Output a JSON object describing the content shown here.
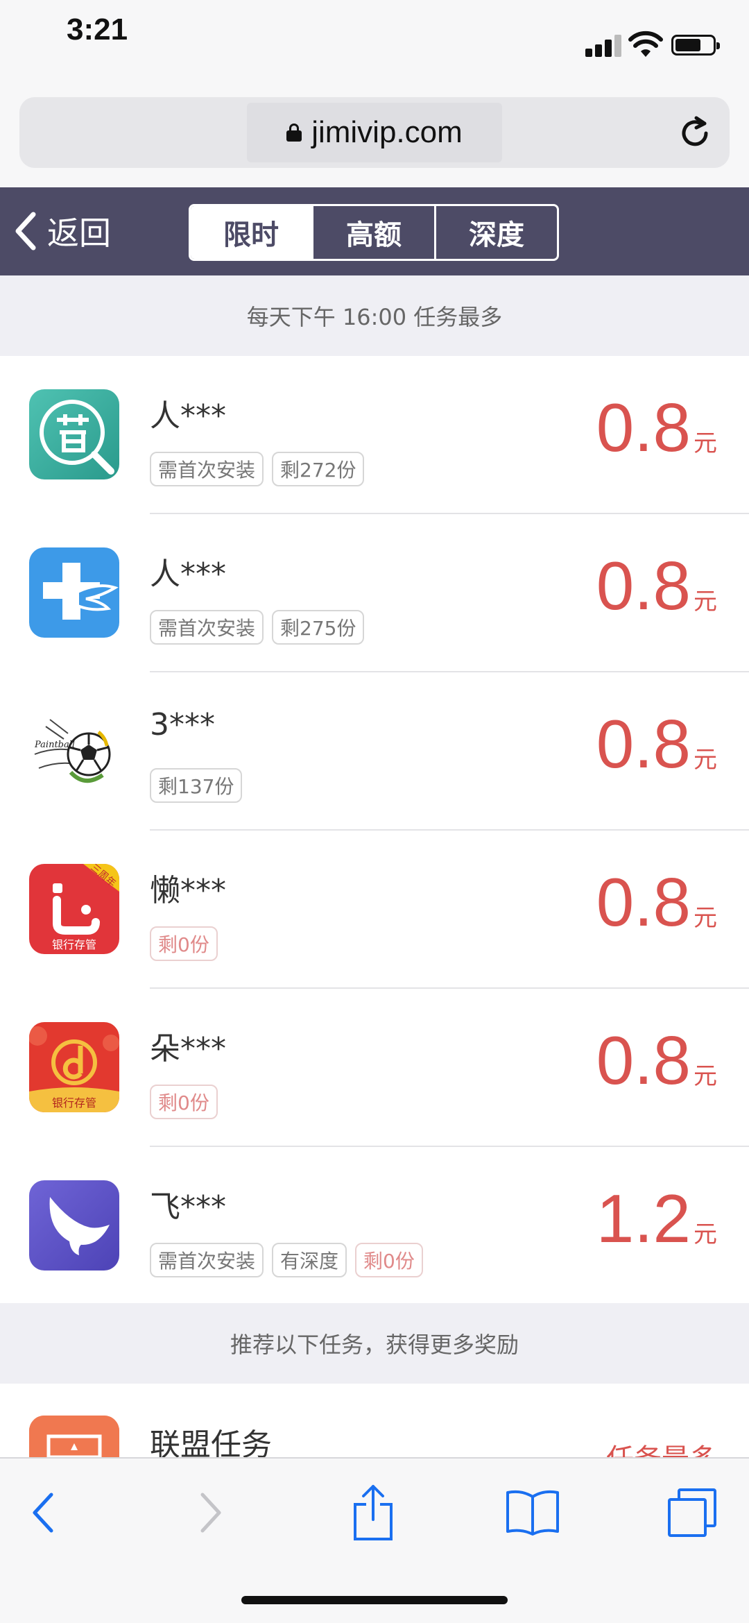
{
  "status_bar": {
    "time": "3:21"
  },
  "browser": {
    "url": "jimivip.com"
  },
  "nav": {
    "back_label": "返回",
    "tabs": [
      {
        "label": "限时",
        "active": true
      },
      {
        "label": "高额",
        "active": false
      },
      {
        "label": "深度",
        "active": false
      }
    ]
  },
  "banner_top": "每天下午 16:00 任务最多",
  "tasks": [
    {
      "name": "人***",
      "tags": [
        {
          "text": "需首次安装",
          "style": "gray"
        },
        {
          "text": "剩272份",
          "style": "gray"
        }
      ],
      "amount": "0.8",
      "unit": "元",
      "icon": "magnifier-app-icon"
    },
    {
      "name": "人***",
      "tags": [
        {
          "text": "需首次安装",
          "style": "gray"
        },
        {
          "text": "剩275份",
          "style": "gray"
        }
      ],
      "amount": "0.8",
      "unit": "元",
      "icon": "medical-cross-app-icon"
    },
    {
      "name": "3***",
      "tags": [
        {
          "text": "剩137份",
          "style": "gray"
        }
      ],
      "amount": "0.8",
      "unit": "元",
      "icon": "soccer-ball-app-icon"
    },
    {
      "name": "懒***",
      "tags": [
        {
          "text": "剩0份",
          "style": "red"
        }
      ],
      "amount": "0.8",
      "unit": "元",
      "icon": "bank-deposit-app-icon"
    },
    {
      "name": "朵***",
      "tags": [
        {
          "text": "剩0份",
          "style": "red"
        }
      ],
      "amount": "0.8",
      "unit": "元",
      "icon": "bank-deposit-d-app-icon"
    },
    {
      "name": "飞***",
      "tags": [
        {
          "text": "需首次安装",
          "style": "gray"
        },
        {
          "text": "有深度",
          "style": "gray"
        },
        {
          "text": "剩0份",
          "style": "red"
        }
      ],
      "amount": "1.2",
      "unit": "元",
      "icon": "bird-app-icon"
    }
  ],
  "banner_bottom": "推荐以下任务，获得更多奖励",
  "alliance": {
    "name": "联盟任务",
    "hint": "任务最多"
  },
  "icon_texts": {
    "bank_badge": "三周年",
    "bank_caption": "银行存管",
    "bank_caption_2": "银行存管",
    "soccer_script": "Paintball"
  },
  "colors": {
    "nav_bg": "#4d4b66",
    "reward_red": "#d9534f",
    "banner_bg": "#efeff4"
  }
}
